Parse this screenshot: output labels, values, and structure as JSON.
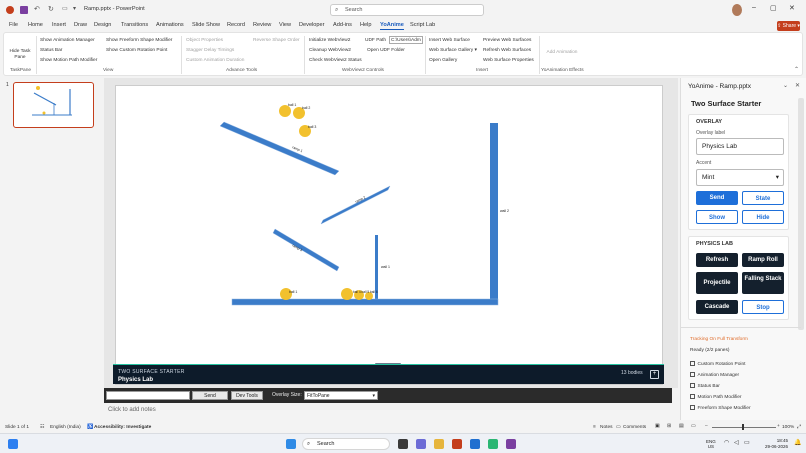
{
  "window": {
    "title": "Ramp.pptx  -  PowerPoint",
    "search_placeholder": "Search"
  },
  "tabs": [
    "File",
    "Home",
    "Insert",
    "Draw",
    "Design",
    "Transitions",
    "Animations",
    "Slide Show",
    "Record",
    "Review",
    "View",
    "Developer",
    "Add-ins",
    "Help",
    "YoAnime",
    "Script Lab"
  ],
  "active_tab": "YoAnime",
  "share_label": "Share",
  "ribbon": {
    "taskpane": {
      "btn": "Hide Task Pane",
      "group": "TaskPane"
    },
    "view": {
      "items": [
        "Show Animation Manager",
        "Status Bar",
        "Show Motion Path Modifier",
        "Show Freeform Shape Modifier",
        "Show Custom Rotation Point"
      ],
      "group": "View"
    },
    "advanced": {
      "items": [
        "Object Properties",
        "Stagger Delay Timings",
        "Custom Animation Duration",
        "Reverse Shape Order"
      ],
      "group": "Advance Tools"
    },
    "webview": {
      "items": [
        "Initialize WebView2",
        "Cleanup WebView2",
        "Check WebView2 Status",
        "UDF Path",
        "Open UDF Folder"
      ],
      "path_value": "C:\\Users\\Adm",
      "group": "WebView2 Controls"
    },
    "insert": {
      "items": [
        "Insert Web Surface",
        "Web Surface Gallery",
        "Open Gallery",
        "Preview Web Surfaces",
        "Refresh Web Surfaces",
        "Web Surface Properties"
      ],
      "group": "Insert"
    },
    "effects": {
      "btn": "Add Animation",
      "group": "YoAnimation Effects"
    }
  },
  "thumbnail": {
    "number": "1"
  },
  "slide": {
    "labels": {
      "ball1": "ball 1",
      "ball2": "ball 2",
      "ball3": "ball 3",
      "ramp1": "ramp 1",
      "ramp2": "ramp 2",
      "ramp3": "ramp 3",
      "wall1": "wall 1",
      "wall2": "wall 2",
      "floorballs": "ball 4 ball 5 ball 6"
    }
  },
  "hud": {
    "title": "TWO SURFACE STARTER",
    "subtitle": "Physics Lab",
    "bodies": "13 bodies"
  },
  "devbar": {
    "send": "Send",
    "devtools": "Dev Tools",
    "overlay_size_label": "Overlay Size:",
    "overlay_size_value": "FitToPane"
  },
  "notes_placeholder": "Click to add notes",
  "taskpane": {
    "title": "YoAnime - Ramp.pptx",
    "heading": "Two Surface Starter",
    "overlay": {
      "section": "OVERLAY",
      "label_caption": "Overlay label",
      "label_value": "Physics Lab",
      "accent_caption": "Accent",
      "accent_value": "Mint",
      "buttons": [
        "Send",
        "State",
        "Show",
        "Hide"
      ]
    },
    "physics": {
      "section": "PHYSICS LAB",
      "buttons": [
        "Refresh",
        "Ramp Roll",
        "Projectile",
        "Falling Stack",
        "Cascade",
        "Stop"
      ]
    },
    "tracking": "Tracking On Full Transform",
    "ready": "Ready (2/2 panes)",
    "checks": [
      "Custom Rotation Point",
      "Animation Manager",
      "Status Bar",
      "Motion Path Modifier",
      "Freeform Shape Modifier"
    ]
  },
  "statusbar": {
    "slide": "Slide 1 of 1",
    "language": "English (India)",
    "accessibility": "Accessibility: Investigate",
    "notes": "Notes",
    "comments": "Comments",
    "zoom": "100%"
  },
  "taskbar": {
    "search": "Search",
    "lang1": "ENG",
    "lang2": "US",
    "time": "18:45",
    "date": "29-06-2026"
  },
  "colors": {
    "accent": "#185abd",
    "ramp": "#3b7cc9",
    "ball": "#f2c12e",
    "hud_bg": "#0d1b2a",
    "mint": "#25c2a0",
    "share": "#c43e1c"
  }
}
